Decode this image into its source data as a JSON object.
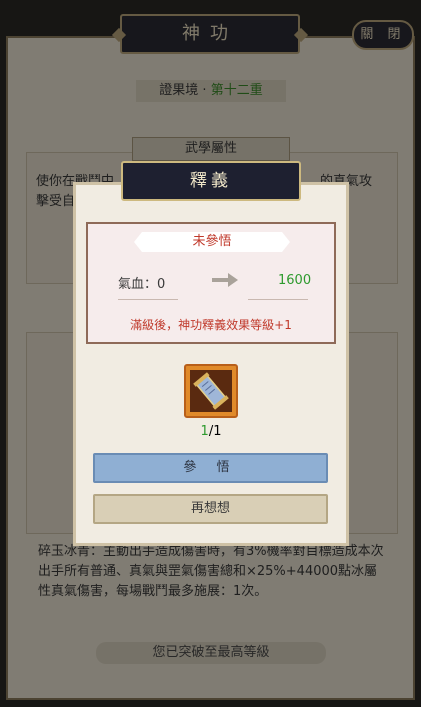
{
  "header": {
    "title": "神功",
    "close_label": "關 閉"
  },
  "realm": {
    "prefix": "證果境 · ",
    "level": "第十二重"
  },
  "attributes": {
    "header": "武學屬性",
    "desc_line1": "使你在戰鬥中",
    "desc_line1_end": "的真氣攻",
    "desc_line2": "擊受自"
  },
  "skill_desc": "碎玉冰青：主動出手造成傷害時，有3%機率對目標造成本次出手所有普通、真氣與罡氣傷害總和×25%+44000點冰屬性真氣傷害，每場戰鬥最多施展：1次。",
  "bottom_status": "您已突破至最高等級",
  "modal": {
    "title": "釋義",
    "status": "未參悟",
    "stat": {
      "label": "氣血：",
      "current": "0",
      "next": "1600"
    },
    "effect": "滿級後，神功釋義效果等級+1",
    "item": {
      "have": "1",
      "sep_need": "/1",
      "icon": "scroll-icon"
    },
    "confirm_label": "參 悟",
    "cancel_label": "再想想"
  }
}
